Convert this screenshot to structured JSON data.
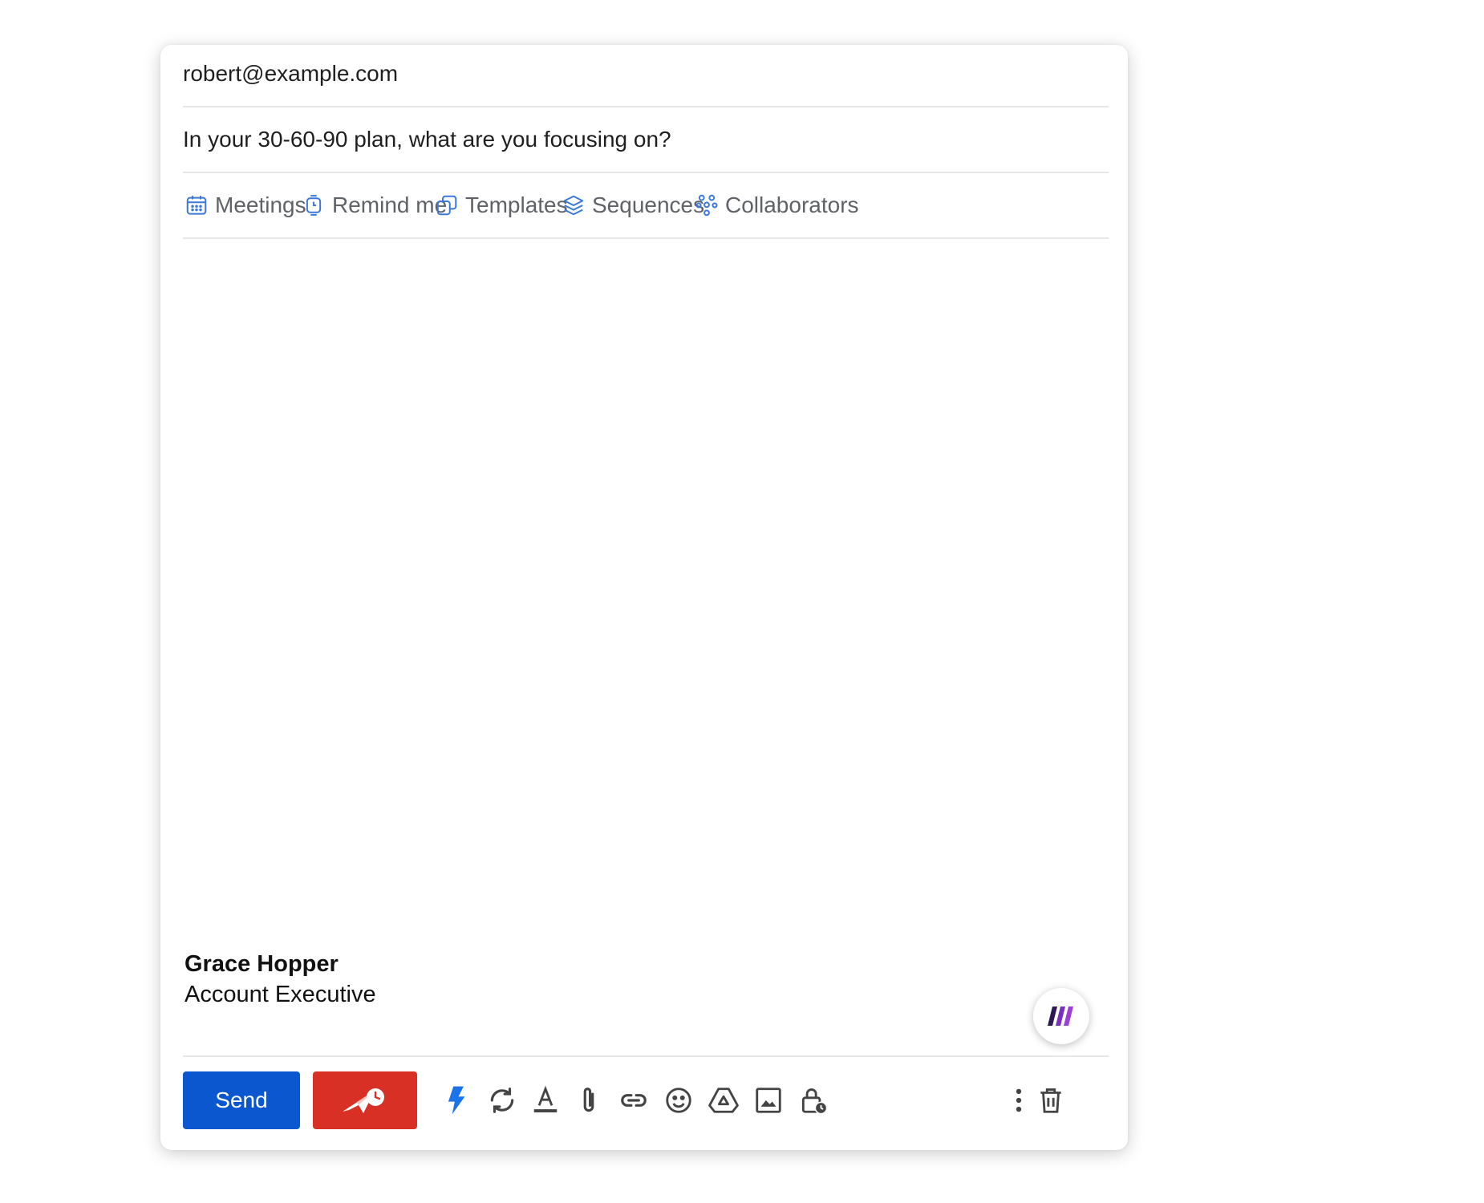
{
  "compose": {
    "to_value": "robert@example.com",
    "subject_value": "In your 30-60-90 plan, what are you focusing on?",
    "tools": [
      {
        "label": "Meetings",
        "icon": "calendar-icon"
      },
      {
        "label": "Remind me",
        "icon": "timer-icon"
      },
      {
        "label": "Templates",
        "icon": "templates-icon"
      },
      {
        "label": "Sequences",
        "icon": "layers-icon"
      },
      {
        "label": "Collaborators",
        "icon": "collaborators-icon"
      }
    ],
    "signature": {
      "name": "Grace Hopper",
      "title": "Account Executive"
    },
    "send_label": "Send",
    "fab_icon": "mixmax-logo-icon",
    "bottom_toolbar": [
      "schedule-send-icon",
      "lightning-icon",
      "refresh-icon",
      "text-format-icon",
      "attach-icon",
      "link-icon",
      "emoji-icon",
      "drive-icon",
      "image-icon",
      "confidential-lock-icon",
      "more-vert-icon",
      "trash-icon"
    ]
  },
  "colors": {
    "send": "#0b57d0",
    "schedule": "#d93025",
    "tool_icon": "#3b78d8",
    "lightning": "#1a73e8",
    "brand_purple": "#7b2fbf"
  }
}
